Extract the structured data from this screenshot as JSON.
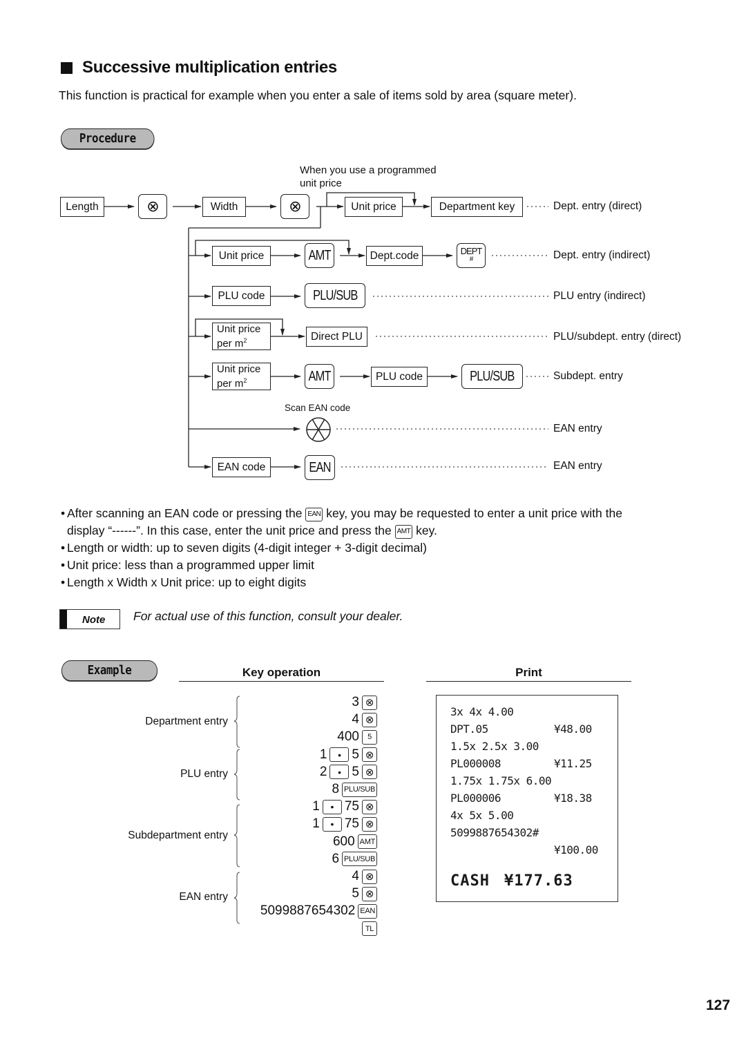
{
  "header": {
    "title": "Successive multiplication entries",
    "intro": "This function is practical for example when you enter a sale of items sold by area (square meter)."
  },
  "procedure": {
    "label": "Procedure",
    "programmed_note_line1": "When you use a programmed",
    "programmed_note_line2": "unit price",
    "main_flow": {
      "length": "Length",
      "width": "Width",
      "multiply_key": "⊗"
    },
    "rows": [
      {
        "steps": [
          "Unit price",
          "Department key"
        ],
        "result": "Dept. entry (direct)"
      },
      {
        "steps": [
          "Unit price",
          "AMT",
          "Dept.code",
          "DEPT #"
        ],
        "result": "Dept. entry (indirect)"
      },
      {
        "steps": [
          "PLU code",
          "PLU/SUB"
        ],
        "result": "PLU entry (indirect)"
      },
      {
        "steps": [
          "Unit price per m2",
          "Direct PLU"
        ],
        "result": "PLU/subdept. entry (direct)"
      },
      {
        "steps": [
          "Unit price per m2",
          "AMT",
          "PLU code",
          "PLU/SUB"
        ],
        "result": "Subdept. entry"
      },
      {
        "steps": [
          "Scan EAN code"
        ],
        "result": "EAN entry"
      },
      {
        "steps": [
          "EAN code",
          "EAN"
        ],
        "result": "EAN entry"
      }
    ],
    "boxes": {
      "unit_price": "Unit price",
      "department_key": "Department key",
      "dept_code": "Dept.code",
      "plu_code": "PLU code",
      "unit_price_per_l1": "Unit price",
      "unit_price_per_l2": "per m",
      "sup2": "2",
      "direct_plu": "Direct PLU",
      "ean_code": "EAN code"
    },
    "keys": {
      "amt": "AMT",
      "dept_top": "DEPT",
      "dept_bottom": "#",
      "plu_sub": "PLU/SUB",
      "ean": "EAN"
    },
    "scan_label": "Scan EAN code",
    "results": {
      "r1": "Dept. entry (direct)",
      "r2": "Dept. entry (indirect)",
      "r3": "PLU entry (indirect)",
      "r4": "PLU/subdept. entry (direct)",
      "r5": "Subdept. entry",
      "r6": "EAN entry",
      "r7": "EAN entry"
    }
  },
  "notes": {
    "bullet1_a": "After scanning an EAN code or pressing the ",
    "bullet1_key1": "EAN",
    "bullet1_b": " key, you may be requested to enter a unit price with the",
    "bullet1_c": "display “------”.  In this case, enter the unit price and press the ",
    "bullet1_key2": "AMT",
    "bullet1_d": " key.",
    "bullet2": "Length or width: up to seven digits (4-digit integer + 3-digit decimal)",
    "bullet3": "Unit price: less than a programmed upper limit",
    "bullet4": "Length x Width x Unit price: up to eight digits",
    "note_label": "Note",
    "note_text": "For actual use of this function, consult your dealer."
  },
  "example": {
    "label": "Example",
    "key_operation_header": "Key operation",
    "print_header": "Print",
    "groups": [
      {
        "label": "Department entry"
      },
      {
        "label": "PLU entry"
      },
      {
        "label": "Subdepartment entry"
      },
      {
        "label": "EAN entry"
      }
    ],
    "key_rows": [
      {
        "pre": "",
        "dot": false,
        "num": "3",
        "key": "⊗"
      },
      {
        "pre": "",
        "dot": false,
        "num": "4",
        "key": "⊗"
      },
      {
        "pre": "",
        "dot": false,
        "num": "400",
        "key": "5"
      },
      {
        "pre": "1",
        "dot": true,
        "num": "5",
        "key": "⊗"
      },
      {
        "pre": "2",
        "dot": true,
        "num": "5",
        "key": "⊗"
      },
      {
        "pre": "",
        "dot": false,
        "num": "8",
        "key": "PLU/SUB"
      },
      {
        "pre": "1",
        "dot": true,
        "num": "75",
        "key": "⊗"
      },
      {
        "pre": "1",
        "dot": true,
        "num": "75",
        "key": "⊗"
      },
      {
        "pre": "",
        "dot": false,
        "num": "600",
        "key": "AMT"
      },
      {
        "pre": "",
        "dot": false,
        "num": "6",
        "key": "PLU/SUB"
      },
      {
        "pre": "",
        "dot": false,
        "num": "4",
        "key": "⊗"
      },
      {
        "pre": "",
        "dot": false,
        "num": "5",
        "key": "⊗"
      },
      {
        "pre": "",
        "dot": false,
        "num": "5099887654302",
        "key": "EAN"
      },
      {
        "pre": "",
        "dot": false,
        "num": "",
        "key": "TL"
      }
    ],
    "dot_key": "•",
    "receipt": [
      {
        "text": "3x 4x 4.00",
        "amount": ""
      },
      {
        "text": "DPT.05",
        "amount": "¥48.00"
      },
      {
        "text": "1.5x 2.5x 3.00",
        "amount": ""
      },
      {
        "text": "PL000008",
        "amount": "¥11.25"
      },
      {
        "text": "1.75x 1.75x 6.00",
        "amount": ""
      },
      {
        "text": "PL000006",
        "amount": "¥18.38"
      },
      {
        "text": "4x 5x 5.00",
        "amount": ""
      },
      {
        "text": "5099887654302#",
        "amount": ""
      },
      {
        "text": "",
        "amount": "¥100.00"
      },
      {
        "text": "CASH",
        "amount": "¥177.63"
      }
    ]
  },
  "page_number": "127"
}
